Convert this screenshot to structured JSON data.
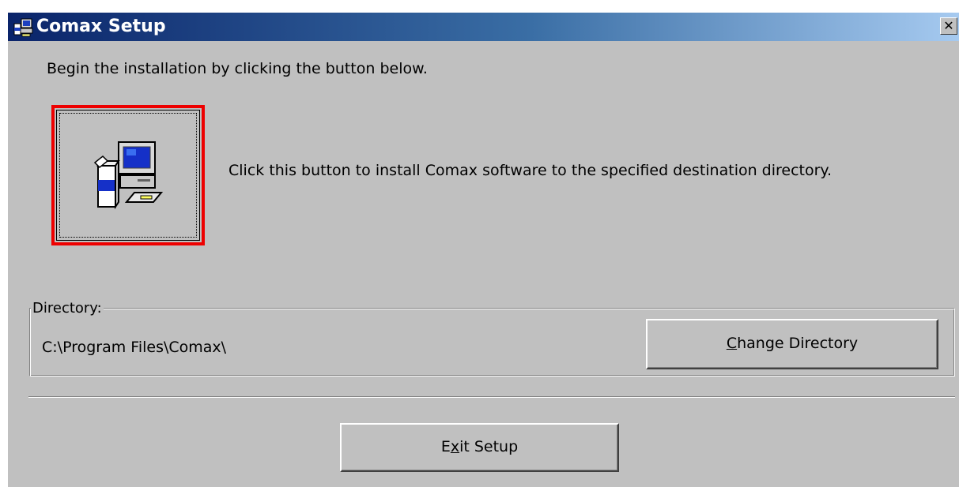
{
  "window": {
    "title": "Comax Setup",
    "app_icon": "setup-computer-icon",
    "close_icon": "close-icon",
    "close_glyph": "✕"
  },
  "main": {
    "intro_text": "Begin the installation by clicking the button below.",
    "install_button_icon": "install-computer-icon",
    "install_description": "Click this button to install Comax software to the specified destination directory."
  },
  "directory": {
    "label": "Directory:",
    "path": "C:\\Program Files\\Comax\\",
    "change_button": {
      "prefix": "",
      "mnemonic": "C",
      "rest": "hange Directory"
    }
  },
  "footer": {
    "exit_button": {
      "prefix": "E",
      "mnemonic": "x",
      "rest": "it Setup"
    }
  },
  "colors": {
    "title_bar_start": "#0a246a",
    "title_bar_end": "#a6caf0",
    "window_face": "#c0c0c0",
    "focus_highlight": "#ee0000"
  }
}
